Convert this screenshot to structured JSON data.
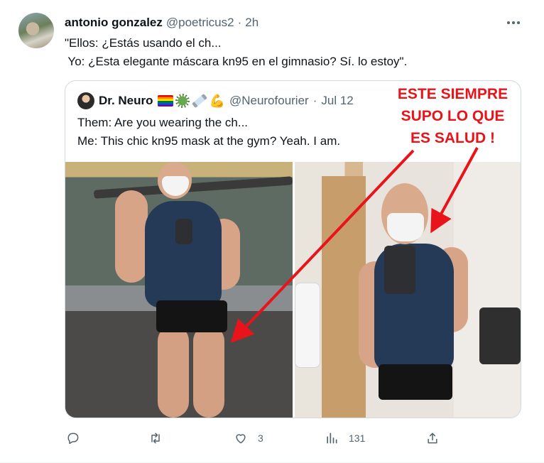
{
  "tweet": {
    "author_name": "antonio gonzalez",
    "author_handle": "@poetricus2",
    "separator": "·",
    "time": "2h",
    "text": "\"Ellos: ¿Estás usando el ch...\n Yo: ¿Esta elegante máscara kn95 en el gimnasio? Sí. lo estoy\"."
  },
  "quoted_tweet": {
    "author_name": "Dr. Neuro",
    "emojis": [
      "rainbow-flag",
      "microbe",
      "syringe",
      "flexed-biceps"
    ],
    "author_handle": "@Neurofourier",
    "separator": "·",
    "time": "Jul 12",
    "text": "Them: Are you wearing the ch...\nMe: This chic kn95 mask at the gym? Yeah. I am."
  },
  "annotation": {
    "lines": [
      "ESTE SIEMPRE",
      "SUPO LO QUE",
      "ES SALUD !"
    ],
    "color": "#e8141a"
  },
  "actions": {
    "reply": "",
    "retweet": "",
    "like": "3",
    "views": "131"
  },
  "colors": {
    "text": "#0f1419",
    "secondary": "#536471",
    "border": "#cfd9de"
  }
}
